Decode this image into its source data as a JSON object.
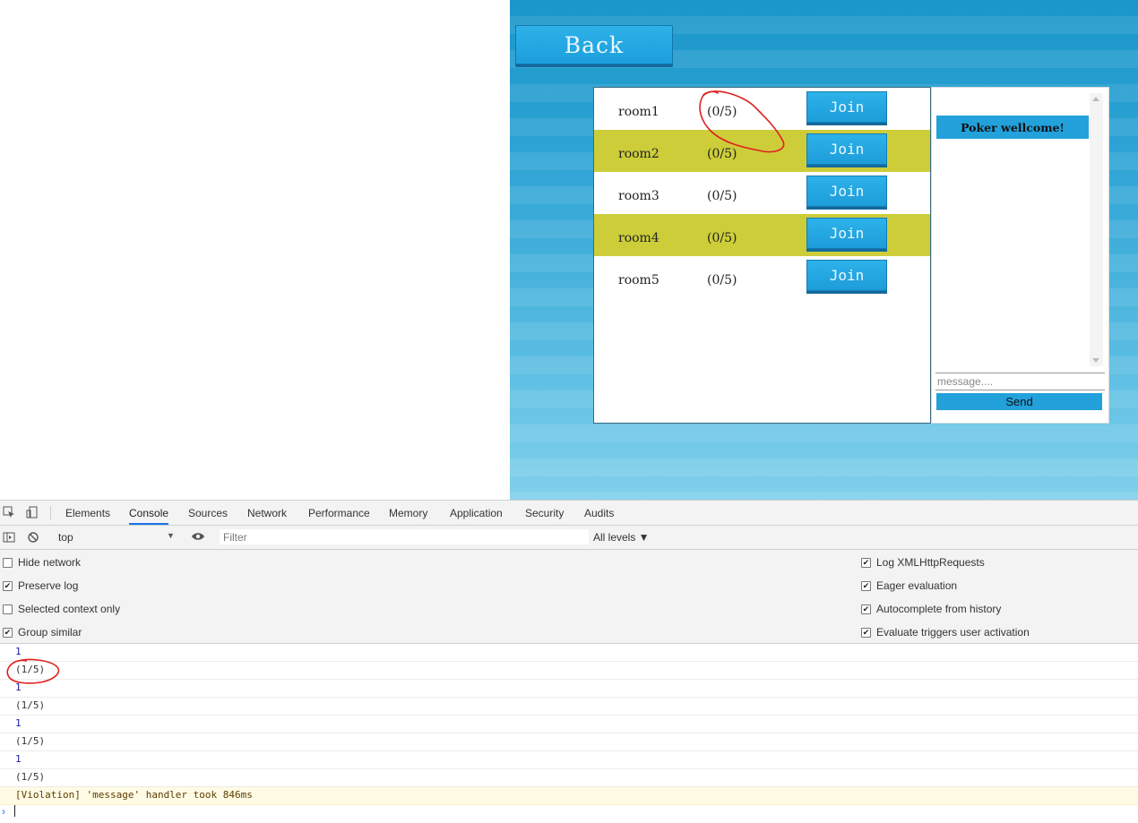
{
  "game": {
    "back_label": "Back",
    "rooms": [
      {
        "name": "room1",
        "count": "(0/5)",
        "join_label": "Join"
      },
      {
        "name": "room2",
        "count": "(0/5)",
        "join_label": "Join"
      },
      {
        "name": "room3",
        "count": "(0/5)",
        "join_label": "Join"
      },
      {
        "name": "room4",
        "count": "(0/5)",
        "join_label": "Join"
      },
      {
        "name": "room5",
        "count": "(0/5)",
        "join_label": "Join"
      }
    ],
    "chat": {
      "welcome": "Poker wellcome!",
      "input_placeholder": "message....",
      "send_label": "Send"
    },
    "colors": {
      "highlight_row": "#cdcd3a",
      "button_blue": "#22a1db",
      "annotation_red": "#e02020"
    }
  },
  "devtools": {
    "tabs": [
      "Elements",
      "Console",
      "Sources",
      "Network",
      "Performance",
      "Memory",
      "Application",
      "Security",
      "Audits"
    ],
    "active_tab": "Console",
    "context": "top",
    "filter_placeholder": "Filter",
    "levels": "All levels ▼",
    "settings_left": [
      {
        "label": "Hide network",
        "checked": false
      },
      {
        "label": "Preserve log",
        "checked": true
      },
      {
        "label": "Selected context only",
        "checked": false
      },
      {
        "label": "Group similar",
        "checked": true
      }
    ],
    "settings_right": [
      {
        "label": "Log XMLHttpRequests",
        "checked": true
      },
      {
        "label": "Eager evaluation",
        "checked": true
      },
      {
        "label": "Autocomplete from history",
        "checked": true
      },
      {
        "label": "Evaluate triggers user activation",
        "checked": true
      }
    ],
    "logs": [
      "1",
      "(1/5)",
      "1",
      "(1/5)",
      "1",
      "(1/5)",
      "1",
      "(1/5)"
    ],
    "violation": "[Violation] 'message' handler took 846ms",
    "prompt_symbol": "›"
  }
}
